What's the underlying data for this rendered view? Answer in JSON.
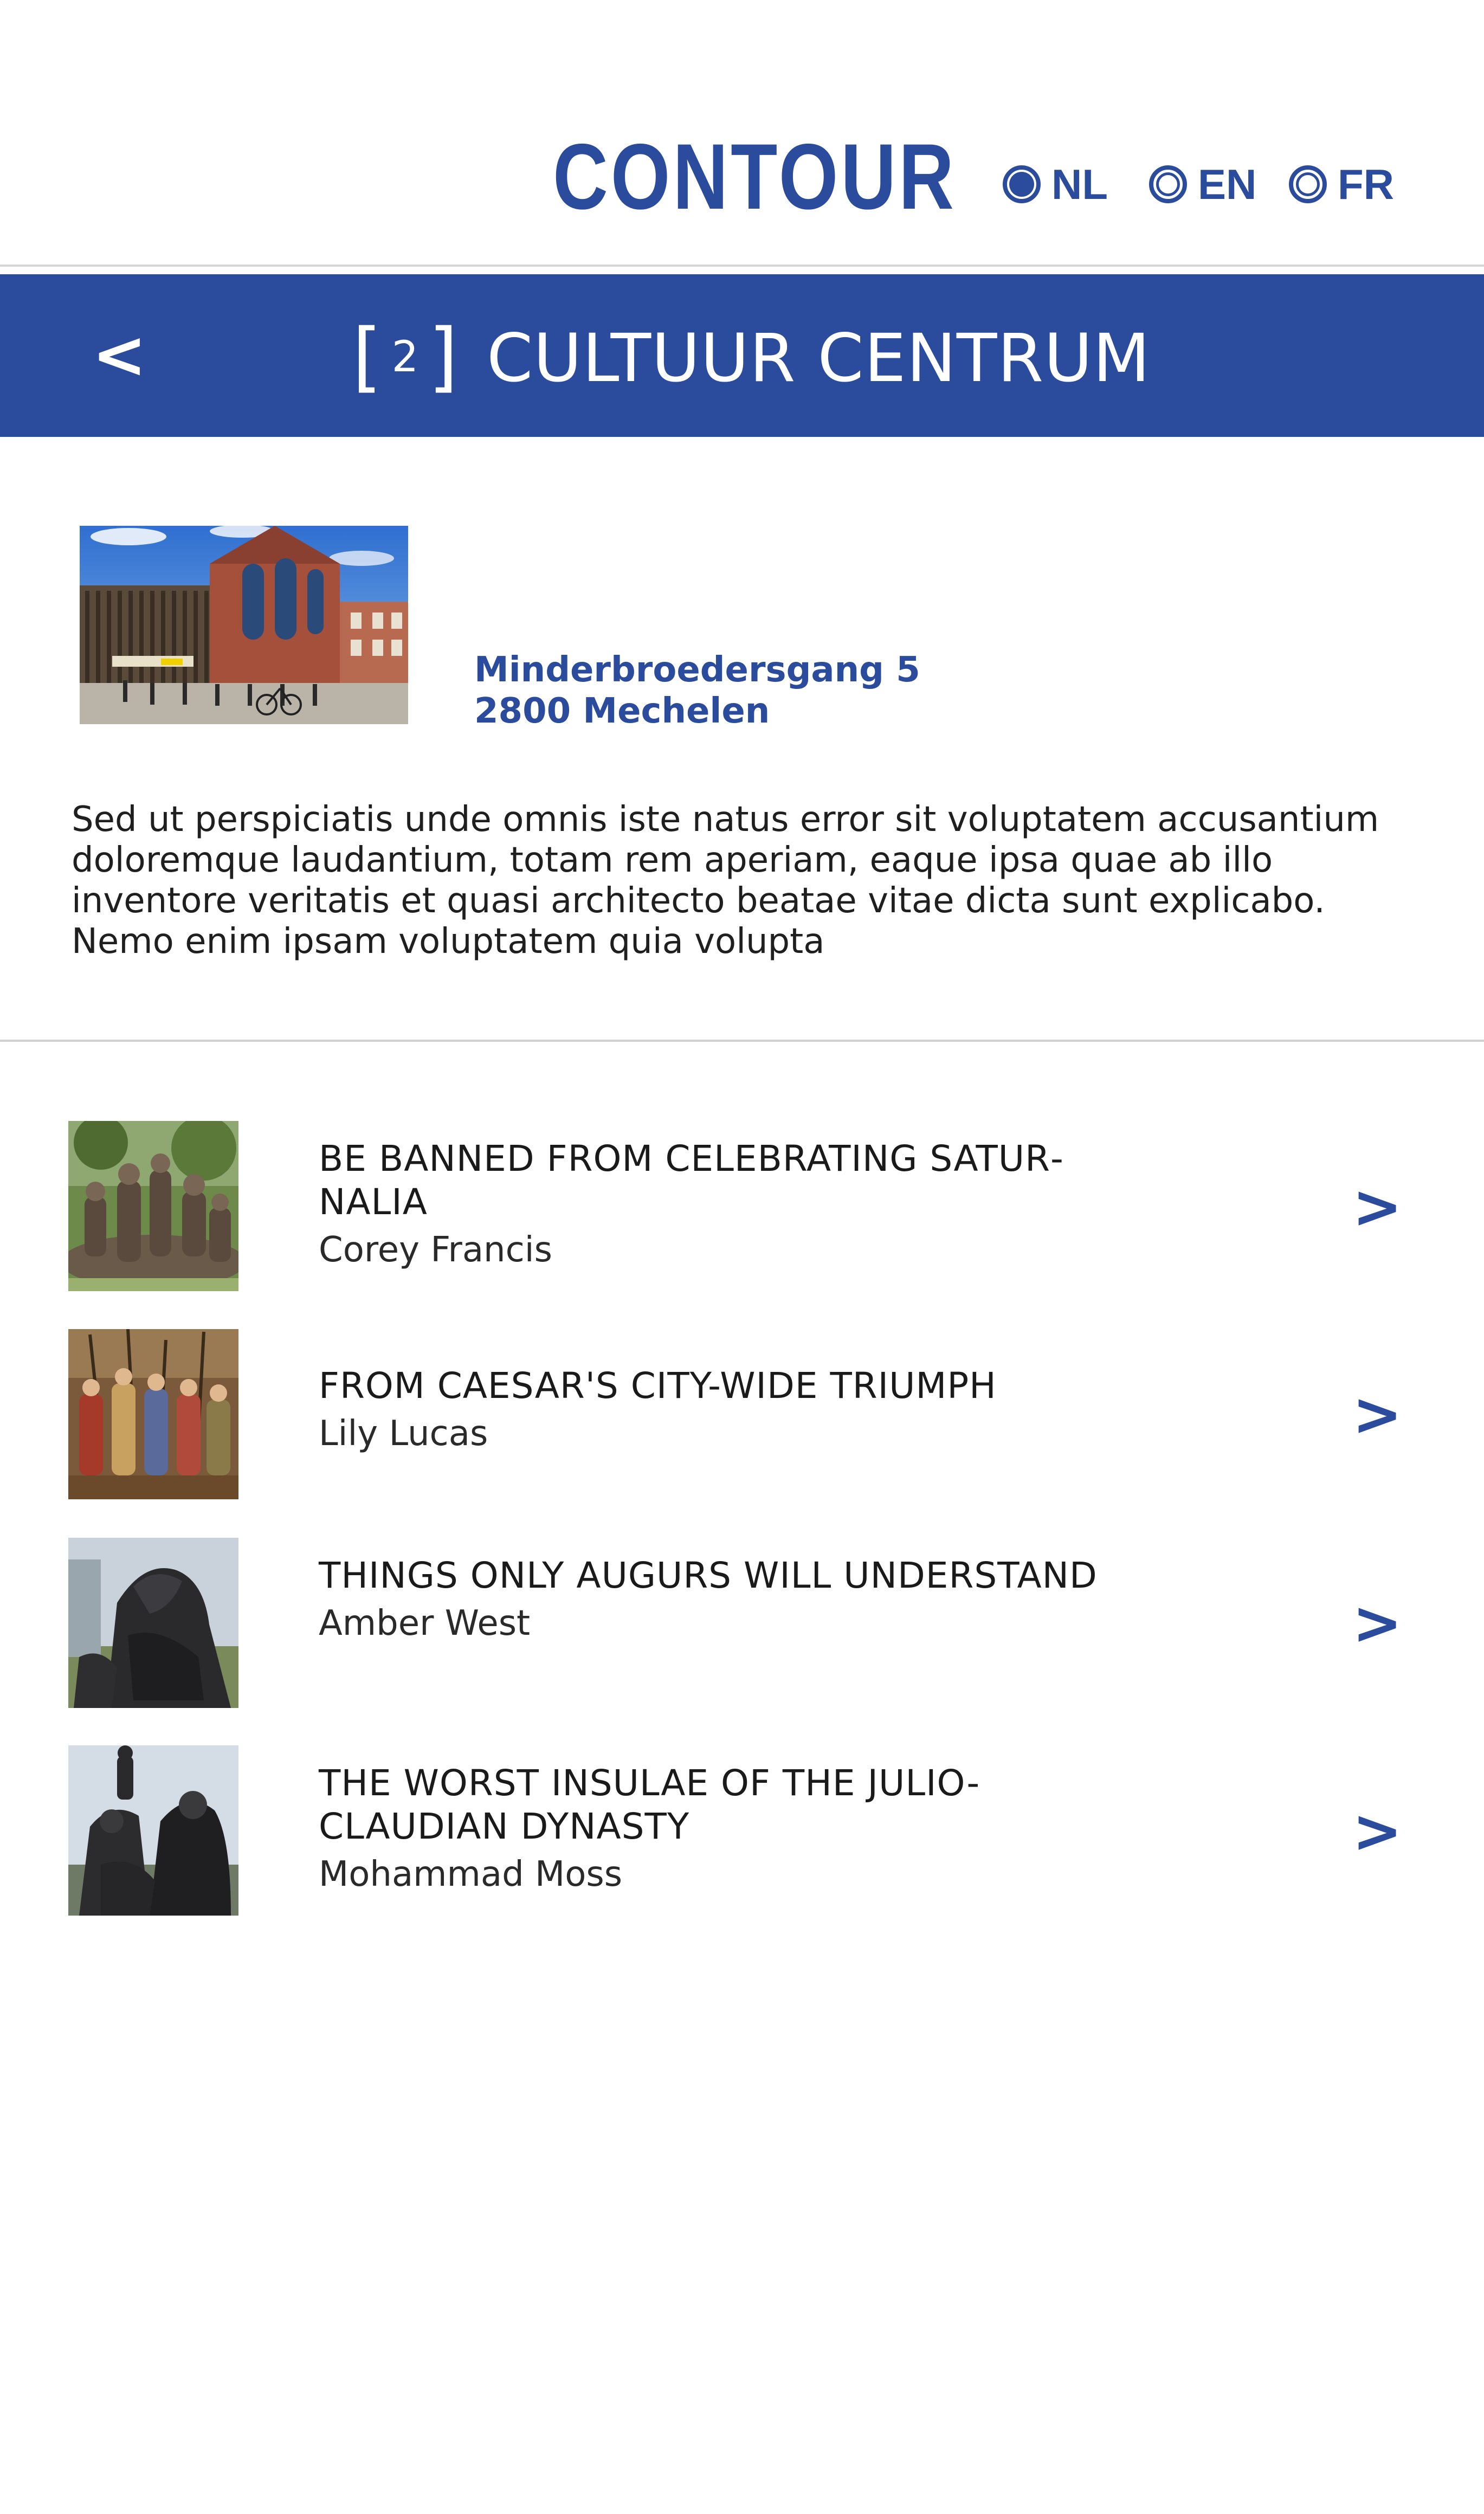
{
  "header": {
    "brand": "CONTOUR",
    "languages": [
      {
        "code": "NL",
        "selected": true
      },
      {
        "code": "EN",
        "selected": false
      },
      {
        "code": "FR",
        "selected": false
      }
    ]
  },
  "titlebar": {
    "back_label": "<",
    "number": "2",
    "title": "CULTUUR CENTRUM"
  },
  "venue": {
    "photo_icon": "building-photo",
    "address_line1": "Minderbroedersgang 5",
    "address_line2": "2800 Mechelen",
    "description": "Sed ut perspiciatis unde omnis iste natus error sit voluptatem accusantium dolorem­que laudantium, totam rem aperiam, eaque ipsa quae ab illo inventore veritatis et quasi architecto beatae vitae dicta sunt explicabo. Nemo enim ipsam voluptatem quia volupta"
  },
  "tours": [
    {
      "title": "BE BANNED FROM CELEBRATING SATUR­NALIA",
      "author": "Corey Francis",
      "chevron": ">"
    },
    {
      "title": "FROM CAESAR'S CITY-WIDE TRIUMPH",
      "author": "Lily Lucas",
      "chevron": ">"
    },
    {
      "title": "THINGS ONLY AUGURS WILL UNDERSTAND",
      "author": "Amber West",
      "chevron": ">"
    },
    {
      "title": "THE WORST INSULAE OF THE JULIO-CLAUDIAN DYNASTY",
      "author": "Mohammad Moss",
      "chevron": ">"
    }
  ],
  "colors": {
    "accent": "#2b4b9c",
    "text": "#1a1a1a",
    "divider": "#d0d0d0"
  }
}
